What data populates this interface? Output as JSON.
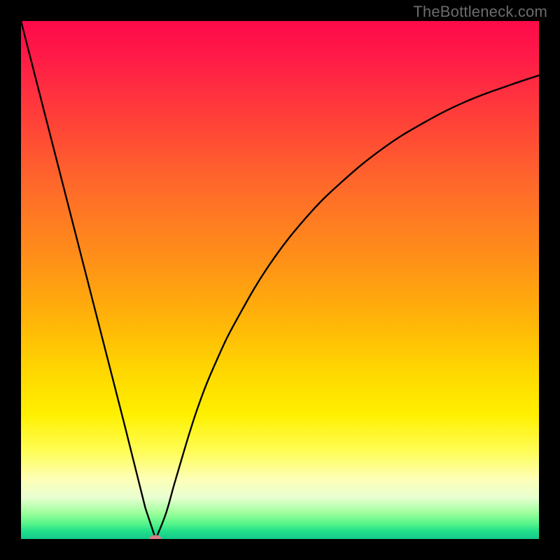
{
  "watermark": "TheBottleneck.com",
  "colors": {
    "frame_bg": "#000000",
    "curve_stroke": "#000000",
    "marker_fill": "#d97e86",
    "watermark_text": "#6c6c6c"
  },
  "chart_data": {
    "type": "line",
    "title": "",
    "xlabel": "",
    "ylabel": "",
    "xlim": [
      0,
      100
    ],
    "ylim": [
      0,
      100
    ],
    "grid": false,
    "legend": false,
    "background": "vertical-gradient red→yellow→green (bottleneck heatmap)",
    "series": [
      {
        "name": "bottleneck-curve",
        "comment": "Single V-shaped curve. Left branch nearly linear, steep; right branch rises with diminishing slope. Minimum ≈ x=26, y≈0.",
        "x": [
          0,
          5,
          10,
          15,
          20,
          24,
          26,
          28,
          30,
          34,
          38,
          42,
          48,
          55,
          62,
          70,
          78,
          86,
          94,
          100
        ],
        "values": [
          100,
          80.5,
          61,
          41.5,
          22,
          6,
          0,
          5,
          12,
          25,
          35,
          43,
          53,
          62,
          69,
          75.5,
          80.5,
          84.5,
          87.5,
          89.5
        ]
      }
    ],
    "marker": {
      "name": "optimal-point",
      "x": 26,
      "y": 0
    }
  }
}
